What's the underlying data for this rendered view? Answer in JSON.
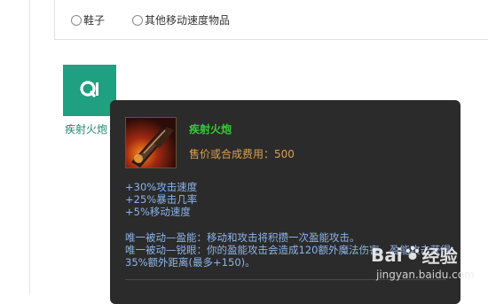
{
  "filters": {
    "options": [
      {
        "label": "鞋子"
      },
      {
        "label": "其他移动速度物品"
      }
    ]
  },
  "item": {
    "tile_label": "疾射火炮",
    "tile_color": "#1fa080"
  },
  "tooltip": {
    "title": "疾射火炮",
    "cost": "售价或合成费用：500",
    "stats": [
      "+30%攻击速度",
      "+25%暴击几率",
      "+5%移动速度"
    ],
    "passives": [
      "唯一被动—盈能：移动和攻击将积攒一次盈能攻击。",
      "唯一被动—锐眼：你的盈能攻击会造成120额外魔法伤害。盈能攻击获得35%额外距离(最多+150)。"
    ],
    "colors": {
      "title": "#33cc33",
      "cost": "#d9a050",
      "body": "#8db4ea",
      "background": "#2b2b2b"
    }
  },
  "watermark": {
    "logo_left": "Bai",
    "logo_right": "经验",
    "url": "jingyan.baidu.com"
  }
}
